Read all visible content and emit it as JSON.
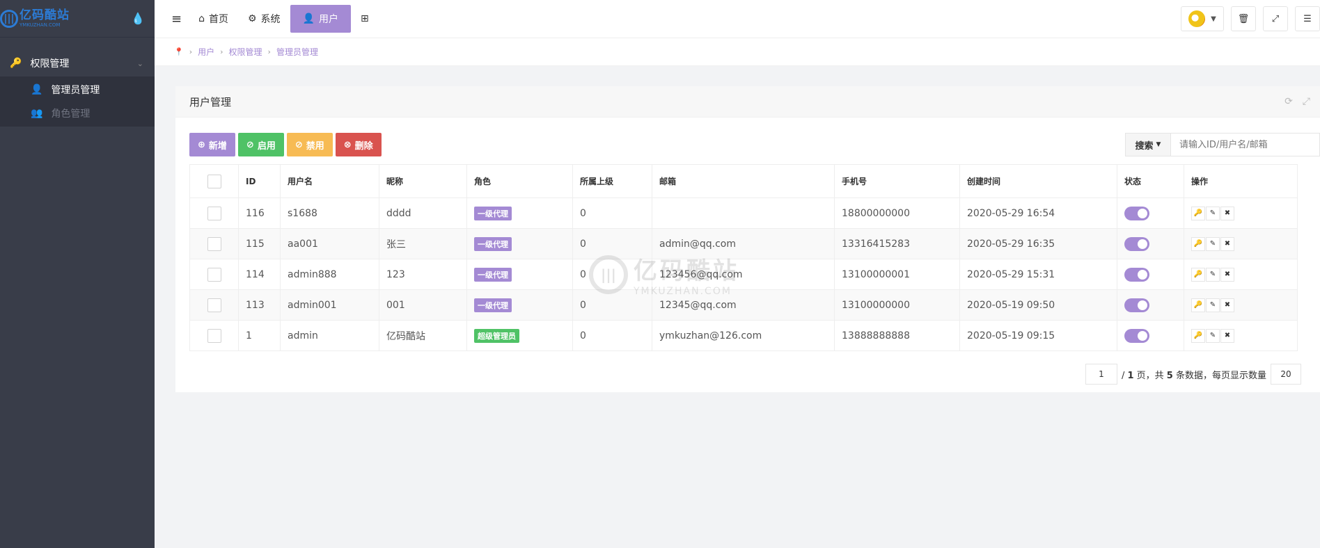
{
  "sidebar": {
    "logo_cn": "亿码酷站",
    "logo_en": "YMKUZHAN.COM",
    "group_title": "权限管理",
    "items": [
      {
        "label": "管理员管理",
        "active": true
      },
      {
        "label": "角色管理",
        "active": false
      }
    ]
  },
  "header": {
    "nav": [
      {
        "label": "首页",
        "icon": "home-icon"
      },
      {
        "label": "系统",
        "icon": "gear-icon"
      },
      {
        "label": "用户",
        "icon": "user-icon",
        "active": true
      }
    ]
  },
  "breadcrumb": [
    "用户",
    "权限管理",
    "管理员管理"
  ],
  "panel": {
    "title": "用户管理",
    "buttons": {
      "add": "新增",
      "enable": "启用",
      "disable": "禁用",
      "delete": "删除"
    },
    "search_label": "搜索",
    "search_placeholder": "请输入ID/用户名/邮箱"
  },
  "table": {
    "headers": [
      "ID",
      "用户名",
      "昵称",
      "角色",
      "所属上级",
      "邮箱",
      "手机号",
      "创建时间",
      "状态",
      "操作"
    ],
    "rows": [
      {
        "id": "116",
        "username": "s1688",
        "nickname": "dddd",
        "role": "一级代理",
        "parent": "0",
        "email": "",
        "phone": "18800000000",
        "created": "2020-05-29 16:54",
        "enabled": true
      },
      {
        "id": "115",
        "username": "aa001",
        "nickname": "张三",
        "role": "一级代理",
        "parent": "0",
        "email": "admin@qq.com",
        "phone": "13316415283",
        "created": "2020-05-29 16:35",
        "enabled": true
      },
      {
        "id": "114",
        "username": "admin888",
        "nickname": "123",
        "role": "一级代理",
        "parent": "0",
        "email": "123456@qq.com",
        "phone": "13100000001",
        "created": "2020-05-29 15:31",
        "enabled": true
      },
      {
        "id": "113",
        "username": "admin001",
        "nickname": "001",
        "role": "一级代理",
        "parent": "0",
        "email": "12345@qq.com",
        "phone": "13100000000",
        "created": "2020-05-19 09:50",
        "enabled": true
      },
      {
        "id": "1",
        "username": "admin",
        "nickname": "亿码酷站",
        "role": "超级管理员",
        "parent": "0",
        "email": "ymkuzhan@126.com",
        "phone": "13888888888",
        "created": "2020-05-19 09:15",
        "enabled": true
      }
    ]
  },
  "pager": {
    "current": "1",
    "total_pages": "1",
    "page_suffix": "页，共",
    "count": "5",
    "count_suffix": "条数据，每页显示数量",
    "page_size": "20"
  },
  "watermark": {
    "cn": "亿码酷站",
    "en": "YMKUZHAN.COM"
  },
  "colors": {
    "accent": "#a48ad4",
    "success": "#4fc266",
    "warning": "#f7bb54",
    "danger": "#d9534f",
    "sidebar": "#393d49"
  }
}
